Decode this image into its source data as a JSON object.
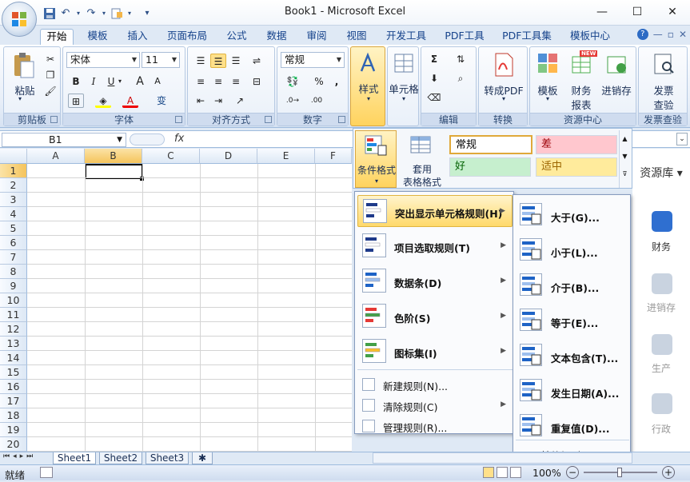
{
  "window": {
    "title": "Book1 - Microsoft Excel",
    "minimize": "—",
    "maximize": "☐",
    "close": "✕"
  },
  "qat": {
    "save_icon": "save-icon",
    "undo_icon": "undo-icon",
    "redo_icon": "redo-icon",
    "more": "▾"
  },
  "tabs": [
    "开始",
    "模板",
    "插入",
    "页面布局",
    "公式",
    "数据",
    "审阅",
    "视图",
    "开发工具",
    "PDF工具",
    "PDF工具集",
    "模板中心"
  ],
  "tab_right": {
    "help": "?",
    "min": "—",
    "restore": "▫",
    "close": "✕"
  },
  "ribbon": {
    "clipboard": {
      "paste": "粘贴",
      "label": "剪贴板"
    },
    "font": {
      "name": "宋体",
      "size": "11",
      "bold": "B",
      "italic": "I",
      "underline": "U",
      "grow": "A",
      "shrink": "A",
      "phonetic": "变",
      "label": "字体"
    },
    "align": {
      "label": "对齐方式"
    },
    "number": {
      "format": "常规",
      "percent": "%",
      "comma": ",",
      "label": "数字"
    },
    "styles": {
      "button": "样式"
    },
    "cells": {
      "button": "单元格"
    },
    "edit": {
      "sigma": "Σ",
      "label": "编辑"
    },
    "convert": {
      "button": "转成PDF",
      "label": "转换"
    },
    "resource": {
      "template": "模板",
      "finance": "财务",
      "finance2": "报表",
      "jxc": "进销存",
      "new_badge": "NEW",
      "label": "资源中心"
    },
    "invoice": {
      "button": "发票",
      "button2": "查验",
      "label": "发票查验"
    }
  },
  "formula": {
    "namebox": "B1",
    "fx": "fx"
  },
  "grid": {
    "columns": [
      "A",
      "B",
      "C",
      "D",
      "E",
      "F"
    ],
    "rows": [
      "1",
      "2",
      "3",
      "4",
      "5",
      "6",
      "7",
      "8",
      "9",
      "10",
      "11",
      "12",
      "13",
      "14",
      "15",
      "16",
      "17",
      "18",
      "19",
      "20"
    ]
  },
  "styles_gallery": {
    "cond_format": "条件格式",
    "table_format": "套用",
    "table_format2": "表格格式",
    "cells": [
      {
        "text": "常规",
        "bg": "#ffffff",
        "color": "#000000"
      },
      {
        "text": "差",
        "bg": "#ffc7ce",
        "color": "#9c0006"
      },
      {
        "text": "好",
        "bg": "#c6efce",
        "color": "#006100"
      },
      {
        "text": "适中",
        "bg": "#ffeb9c",
        "color": "#9c6500"
      }
    ]
  },
  "menu1": {
    "items": [
      {
        "label": "突出显示单元格规则(H)",
        "icon": "highlight-rules-icon"
      },
      {
        "label": "项目选取规则(T)",
        "icon": "top-bottom-icon"
      },
      {
        "label": "数据条(D)",
        "icon": "data-bars-icon"
      },
      {
        "label": "色阶(S)",
        "icon": "color-scales-icon"
      },
      {
        "label": "图标集(I)",
        "icon": "icon-sets-icon"
      }
    ],
    "small": [
      {
        "label": "新建规则(N)..."
      },
      {
        "label": "清除规则(C)"
      },
      {
        "label": "管理规则(R)..."
      }
    ]
  },
  "menu2": {
    "items": [
      {
        "label": "大于(G)..."
      },
      {
        "label": "小于(L)..."
      },
      {
        "label": "介于(B)..."
      },
      {
        "label": "等于(E)..."
      },
      {
        "label": "文本包含(T)..."
      },
      {
        "label": "发生日期(A)..."
      },
      {
        "label": "重复值(D)..."
      }
    ],
    "more": "其他规则(M)..."
  },
  "right_panel": {
    "title": "资源库",
    "items": [
      "财务",
      "进销存",
      "生产",
      "行政"
    ]
  },
  "sheets": [
    "Sheet1",
    "Sheet2",
    "Sheet3"
  ],
  "status": {
    "ready": "就绪",
    "zoom": "100%",
    "minus": "−",
    "plus": "+"
  }
}
